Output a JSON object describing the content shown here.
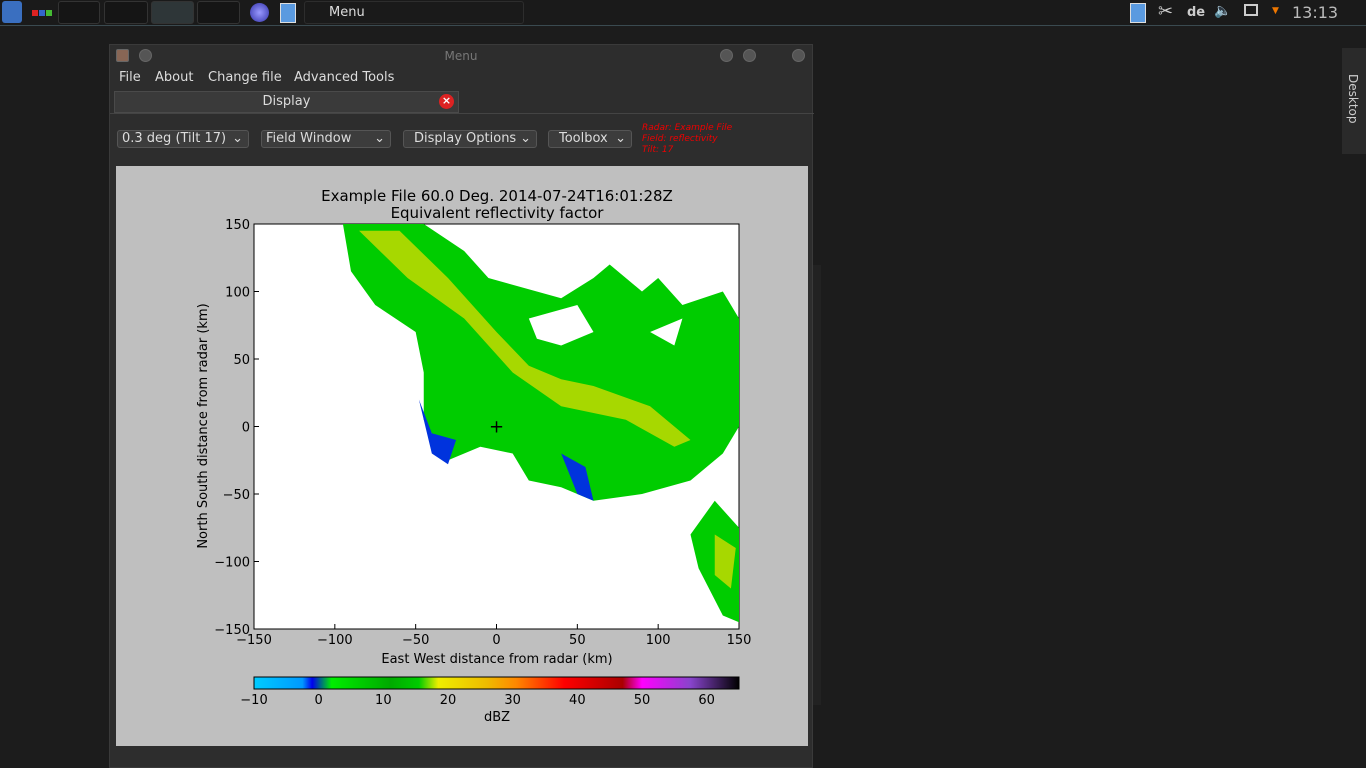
{
  "taskbar": {
    "task_label": "Menu",
    "lang": "de",
    "clock": "13:13"
  },
  "desktop_tab": "Desktop",
  "window": {
    "title": "Menu",
    "menu": [
      "File",
      "About",
      "Change file",
      "Advanced Tools"
    ],
    "tab": "Display",
    "controls": {
      "tilt": "0.3 deg (Tilt 17)",
      "field": "Field Window",
      "display_options": "Display Options",
      "toolbox": "Toolbox"
    },
    "info": [
      "Radar: Example File",
      "Field: reflectivity",
      "Tilt: 17"
    ],
    "info_color": "#ff0000"
  },
  "chart_data": {
    "type": "heatmap",
    "title": "Example File 60.0 Deg. 2014-07-24T16:01:28Z",
    "subtitle": "Equivalent reflectivity factor",
    "xlabel": "East West distance from radar (km)",
    "ylabel": "North South distance from radar (km)",
    "xlim": [
      -150,
      150
    ],
    "ylim": [
      -150,
      150
    ],
    "xticks": [
      -150,
      -100,
      -50,
      0,
      50,
      100,
      150
    ],
    "yticks": [
      -150,
      -100,
      -50,
      0,
      50,
      100,
      150
    ],
    "colorbar": {
      "label": "dBZ",
      "range": [
        -10,
        65
      ],
      "ticks": [
        -10,
        0,
        10,
        20,
        30,
        40,
        50,
        60
      ]
    },
    "radar_marker": [
      0,
      0
    ]
  }
}
